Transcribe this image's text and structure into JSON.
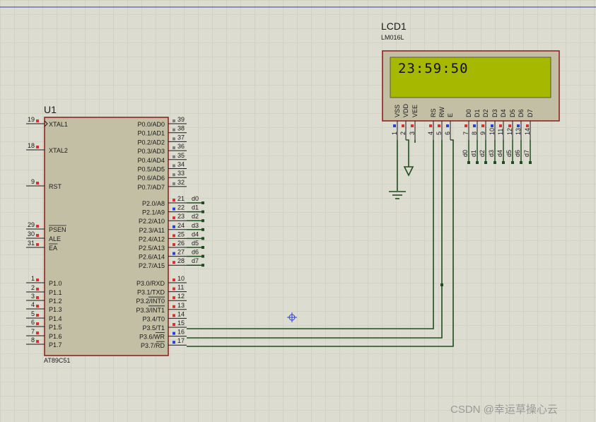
{
  "u1": {
    "ref": "U1",
    "part": "AT89C51",
    "left_pins": [
      {
        "num": "19",
        "label": "XTAL1",
        "clock": true
      },
      {
        "num": "18",
        "label": "XTAL2"
      },
      {
        "num": "9",
        "label": "RST"
      },
      {
        "num": "29",
        "label": "PSEN",
        "overbar": true
      },
      {
        "num": "30",
        "label": "ALE"
      },
      {
        "num": "31",
        "label": "EA",
        "overbar": true
      },
      {
        "num": "1",
        "label": "P1.0"
      },
      {
        "num": "2",
        "label": "P1.1"
      },
      {
        "num": "3",
        "label": "P1.2"
      },
      {
        "num": "4",
        "label": "P1.3"
      },
      {
        "num": "5",
        "label": "P1.4"
      },
      {
        "num": "6",
        "label": "P1.5"
      },
      {
        "num": "7",
        "label": "P1.6"
      },
      {
        "num": "8",
        "label": "P1.7"
      }
    ],
    "right_pins": [
      {
        "num": "39",
        "label": "P0.0/AD0"
      },
      {
        "num": "38",
        "label": "P0.1/AD1"
      },
      {
        "num": "37",
        "label": "P0.2/AD2"
      },
      {
        "num": "36",
        "label": "P0.3/AD3"
      },
      {
        "num": "35",
        "label": "P0.4/AD4"
      },
      {
        "num": "34",
        "label": "P0.5/AD5"
      },
      {
        "num": "33",
        "label": "P0.6/AD6"
      },
      {
        "num": "32",
        "label": "P0.7/AD7"
      },
      {
        "num": "21",
        "label": "P2.0/A8",
        "net": "d0"
      },
      {
        "num": "22",
        "label": "P2.1/A9",
        "net": "d1"
      },
      {
        "num": "23",
        "label": "P2.2/A10",
        "net": "d2"
      },
      {
        "num": "24",
        "label": "P2.3/A11",
        "net": "d3"
      },
      {
        "num": "25",
        "label": "P2.4/A12",
        "net": "d4"
      },
      {
        "num": "26",
        "label": "P2.5/A13",
        "net": "d5"
      },
      {
        "num": "27",
        "label": "P2.6/A14",
        "net": "d6"
      },
      {
        "num": "28",
        "label": "P2.7/A15",
        "net": "d7"
      },
      {
        "num": "10",
        "label": "P3.0/RXD"
      },
      {
        "num": "11",
        "label": "P3.1/TXD"
      },
      {
        "num": "12",
        "label": "P3.2/INT0"
      },
      {
        "num": "13",
        "label": "P3.3/INT1"
      },
      {
        "num": "14",
        "label": "P3.4/T0"
      },
      {
        "num": "15",
        "label": "P3.5/T1"
      },
      {
        "num": "16",
        "label": "P3.6/WR"
      },
      {
        "num": "17",
        "label": "P3.7/RD"
      }
    ]
  },
  "lcd": {
    "ref": "LCD1",
    "part": "LM016L",
    "display_text": "23:59:50",
    "pins": [
      {
        "num": "1",
        "label": "VSS"
      },
      {
        "num": "2",
        "label": "VDD"
      },
      {
        "num": "3",
        "label": "VEE"
      },
      {
        "num": "4",
        "label": "RS"
      },
      {
        "num": "5",
        "label": "RW"
      },
      {
        "num": "6",
        "label": "E"
      },
      {
        "num": "7",
        "label": "D0",
        "net": "d0"
      },
      {
        "num": "8",
        "label": "D1",
        "net": "d1"
      },
      {
        "num": "9",
        "label": "D2",
        "net": "d2"
      },
      {
        "num": "10",
        "label": "D3",
        "net": "d3"
      },
      {
        "num": "11",
        "label": "D4",
        "net": "d4"
      },
      {
        "num": "12",
        "label": "D5",
        "net": "d5"
      },
      {
        "num": "13",
        "label": "D6",
        "net": "d6"
      },
      {
        "num": "14",
        "label": "D7",
        "net": "d7"
      }
    ]
  },
  "watermark": "CSDN @幸运草操心云",
  "colors": {
    "background": "#dcdcd0",
    "grid": "#c7c7b8",
    "component_body": "#c2bfa4",
    "component_border": "#8b1a1a",
    "wire": "#1f4d1f",
    "lcd_screen": "#a6b800",
    "pin_red": "#d93030",
    "pin_blue": "#2a3fd6",
    "pin_gray": "#808080"
  }
}
